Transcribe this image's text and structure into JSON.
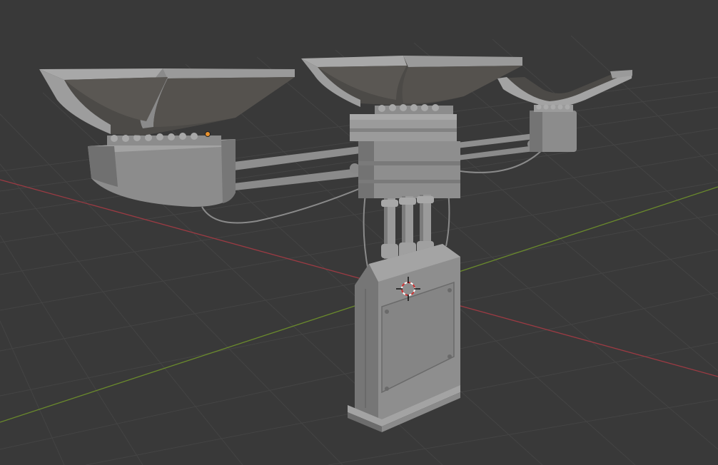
{
  "viewport": {
    "background_color": "#393939",
    "grid_color": "#444444",
    "axis_x_color": "#9b3a43",
    "axis_y_color": "#6a8a2c",
    "model_light": "#9d9d9d",
    "model_mid": "#7e7e7e",
    "model_dark": "#5c5c5c",
    "model_shadow": "#4c4a47",
    "origin_marker_color": "#e8912d",
    "cursor_ring_colors": [
      "#cc3333",
      "#ffffff"
    ],
    "cursor_icon": "3d-cursor-icon",
    "origin_icon": "object-origin-dot-icon"
  }
}
